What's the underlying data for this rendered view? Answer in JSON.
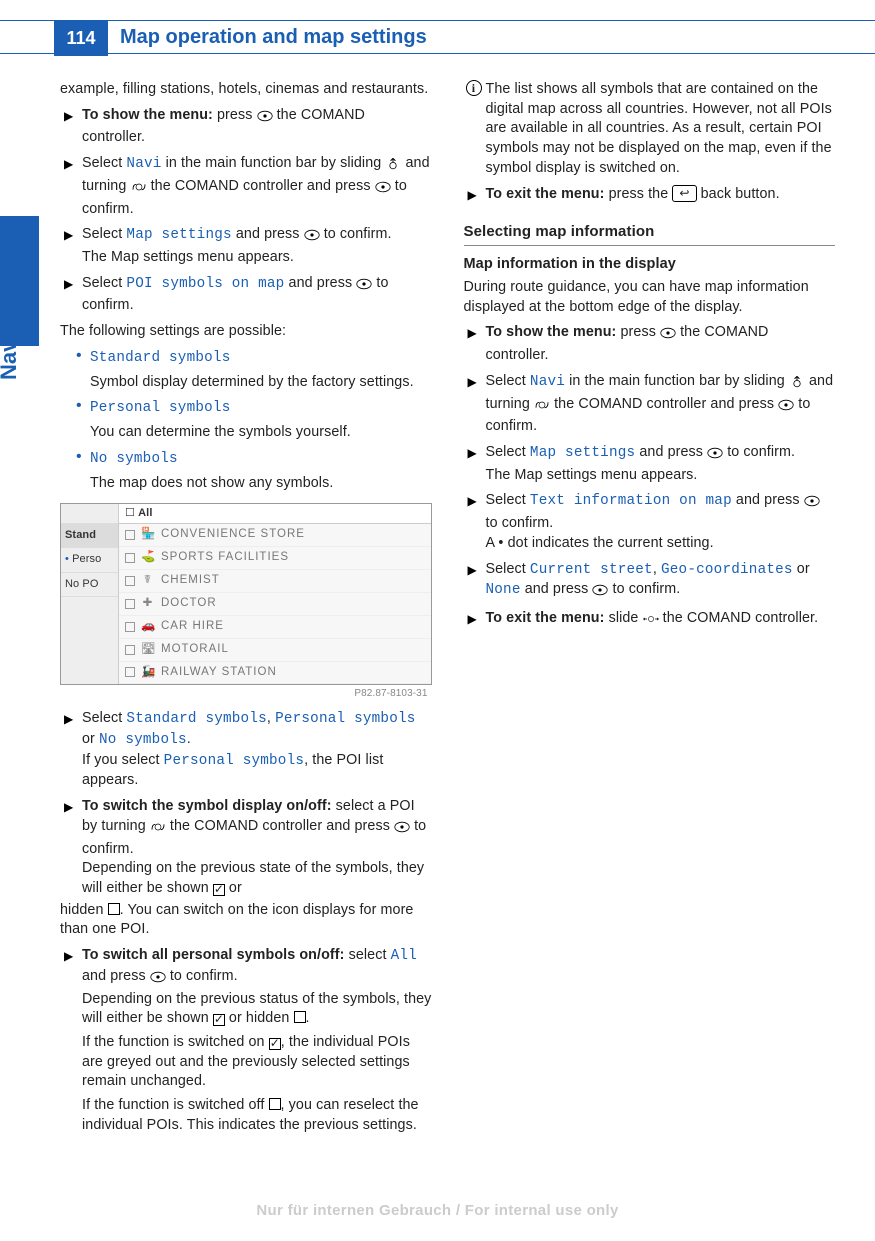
{
  "header": {
    "page_number": "114",
    "title": "Map operation and map settings"
  },
  "side_tab": "Navigation",
  "watermark": "Nur für internen Gebrauch / For internal use only",
  "txt": {
    "intro": "example, filling stations, hotels, cinemas and restaurants.",
    "show_menu_b": "To show the menu:",
    "show_menu_r": " press ",
    "show_menu_r2": " the COMAND controller.",
    "sel_navi_1": "Select ",
    "navi": "Navi",
    "sel_navi_2": " in the main function bar by sliding ",
    "sel_navi_3": " and turning ",
    "sel_navi_4": " the COMAND controller and press ",
    "sel_navi_5": " to confirm.",
    "sel_map_1": "Select ",
    "mapset": "Map settings",
    "sel_map_2": " and press ",
    "sel_map_3": " to confirm.",
    "map_menu": "The Map settings menu appears.",
    "sel_poi_1": "Select ",
    "poi_sym": "POI symbols on map",
    "sel_poi_2": " and press ",
    "sel_poi_3": " to confirm.",
    "possible": "The following settings are possible:",
    "std_sym": "Standard symbols",
    "std_desc": "Symbol display determined by the factory settings.",
    "pers_sym": "Personal symbols",
    "pers_desc": "You can determine the symbols yourself.",
    "no_sym": "No symbols",
    "no_desc": "The map does not show any symbols.",
    "sel_sym_1": "Select ",
    "sel_sym_2": ", ",
    "sel_sym_3": " or ",
    "sel_sym_4": ".",
    "if_pers_1": "If you select ",
    "if_pers_2": ", the POI list appears.",
    "switch_b": "To switch the symbol display on/off:",
    "switch_1": " select a POI by turning ",
    "switch_2": " the COMAND controller and press ",
    "switch_3": " to confirm.",
    "dep_prev": "Depending on the previous state of the symbols, they will either be shown ",
    "dep_or": " or",
    "hidden_1": "hidden ",
    "hidden_2": ". You can switch on the icon displays for more than one POI.",
    "all_b": "To switch all personal symbols on/off:",
    "all_1": " select ",
    "all_m": "All",
    "all_2": " and press ",
    "all_3": " to confirm.",
    "dep2": "Depending on the previous status of the symbols, they will either be shown ",
    "dep2_or": " or hidden ",
    "dep2_end": ".",
    "if_on_1": "If the function is switched on ",
    "if_on_2": ", the individual POIs are greyed out and the previously selected settings remain unchanged.",
    "if_off_1": "If the function is switched off ",
    "if_off_2": ", you can reselect the individual POIs. This indicates the previous settings.",
    "info": "The list shows all symbols that are contained on the digital map across all countries. However, not all POIs are available in all countries. As a result, certain POI symbols may not be displayed on the map, even if the symbol display is switched on.",
    "exit_b": "To exit the menu:",
    "exit_1": " press the ",
    "exit_2": " back button.",
    "sec": "Selecting map information",
    "sub": "Map information in the display",
    "during": "During route guidance, you can have map information displayed at the bottom edge of the display.",
    "sel_text_1": "Select ",
    "text_info": "Text information on map",
    "sel_text_2": " and press ",
    "sel_text_3": " to confirm.",
    "dot_1": "A ",
    "dot_2": " dot indicates the current setting.",
    "dot_sym": "•",
    "sel_cur_1": "Select ",
    "cur_street": "Current street",
    "sel_cur_2": ", ",
    "geo": "Geo-coordinates",
    "sel_cur_3": " or ",
    "none": "None",
    "sel_cur_4": " and press ",
    "sel_cur_5": " to confirm.",
    "exit2_b": "To exit the menu:",
    "exit2_1": " slide ",
    "exit2_2": " the COMAND controller.",
    "back_glyph": "↩"
  },
  "fig": {
    "all": "All",
    "left": [
      "Stand",
      "Perso",
      "No PO"
    ],
    "rows": [
      {
        "i": "🏪",
        "t": "CONVENIENCE STORE"
      },
      {
        "i": "⛳",
        "t": "SPORTS FACILITIES"
      },
      {
        "i": "☤",
        "t": "CHEMIST"
      },
      {
        "i": "✚",
        "t": "DOCTOR"
      },
      {
        "i": "🚗",
        "t": "CAR HIRE"
      },
      {
        "i": "🛣",
        "t": "MOTORAIL"
      },
      {
        "i": "🚂",
        "t": "RAILWAY STATION"
      }
    ],
    "caption": "P82.87-8103-31"
  }
}
